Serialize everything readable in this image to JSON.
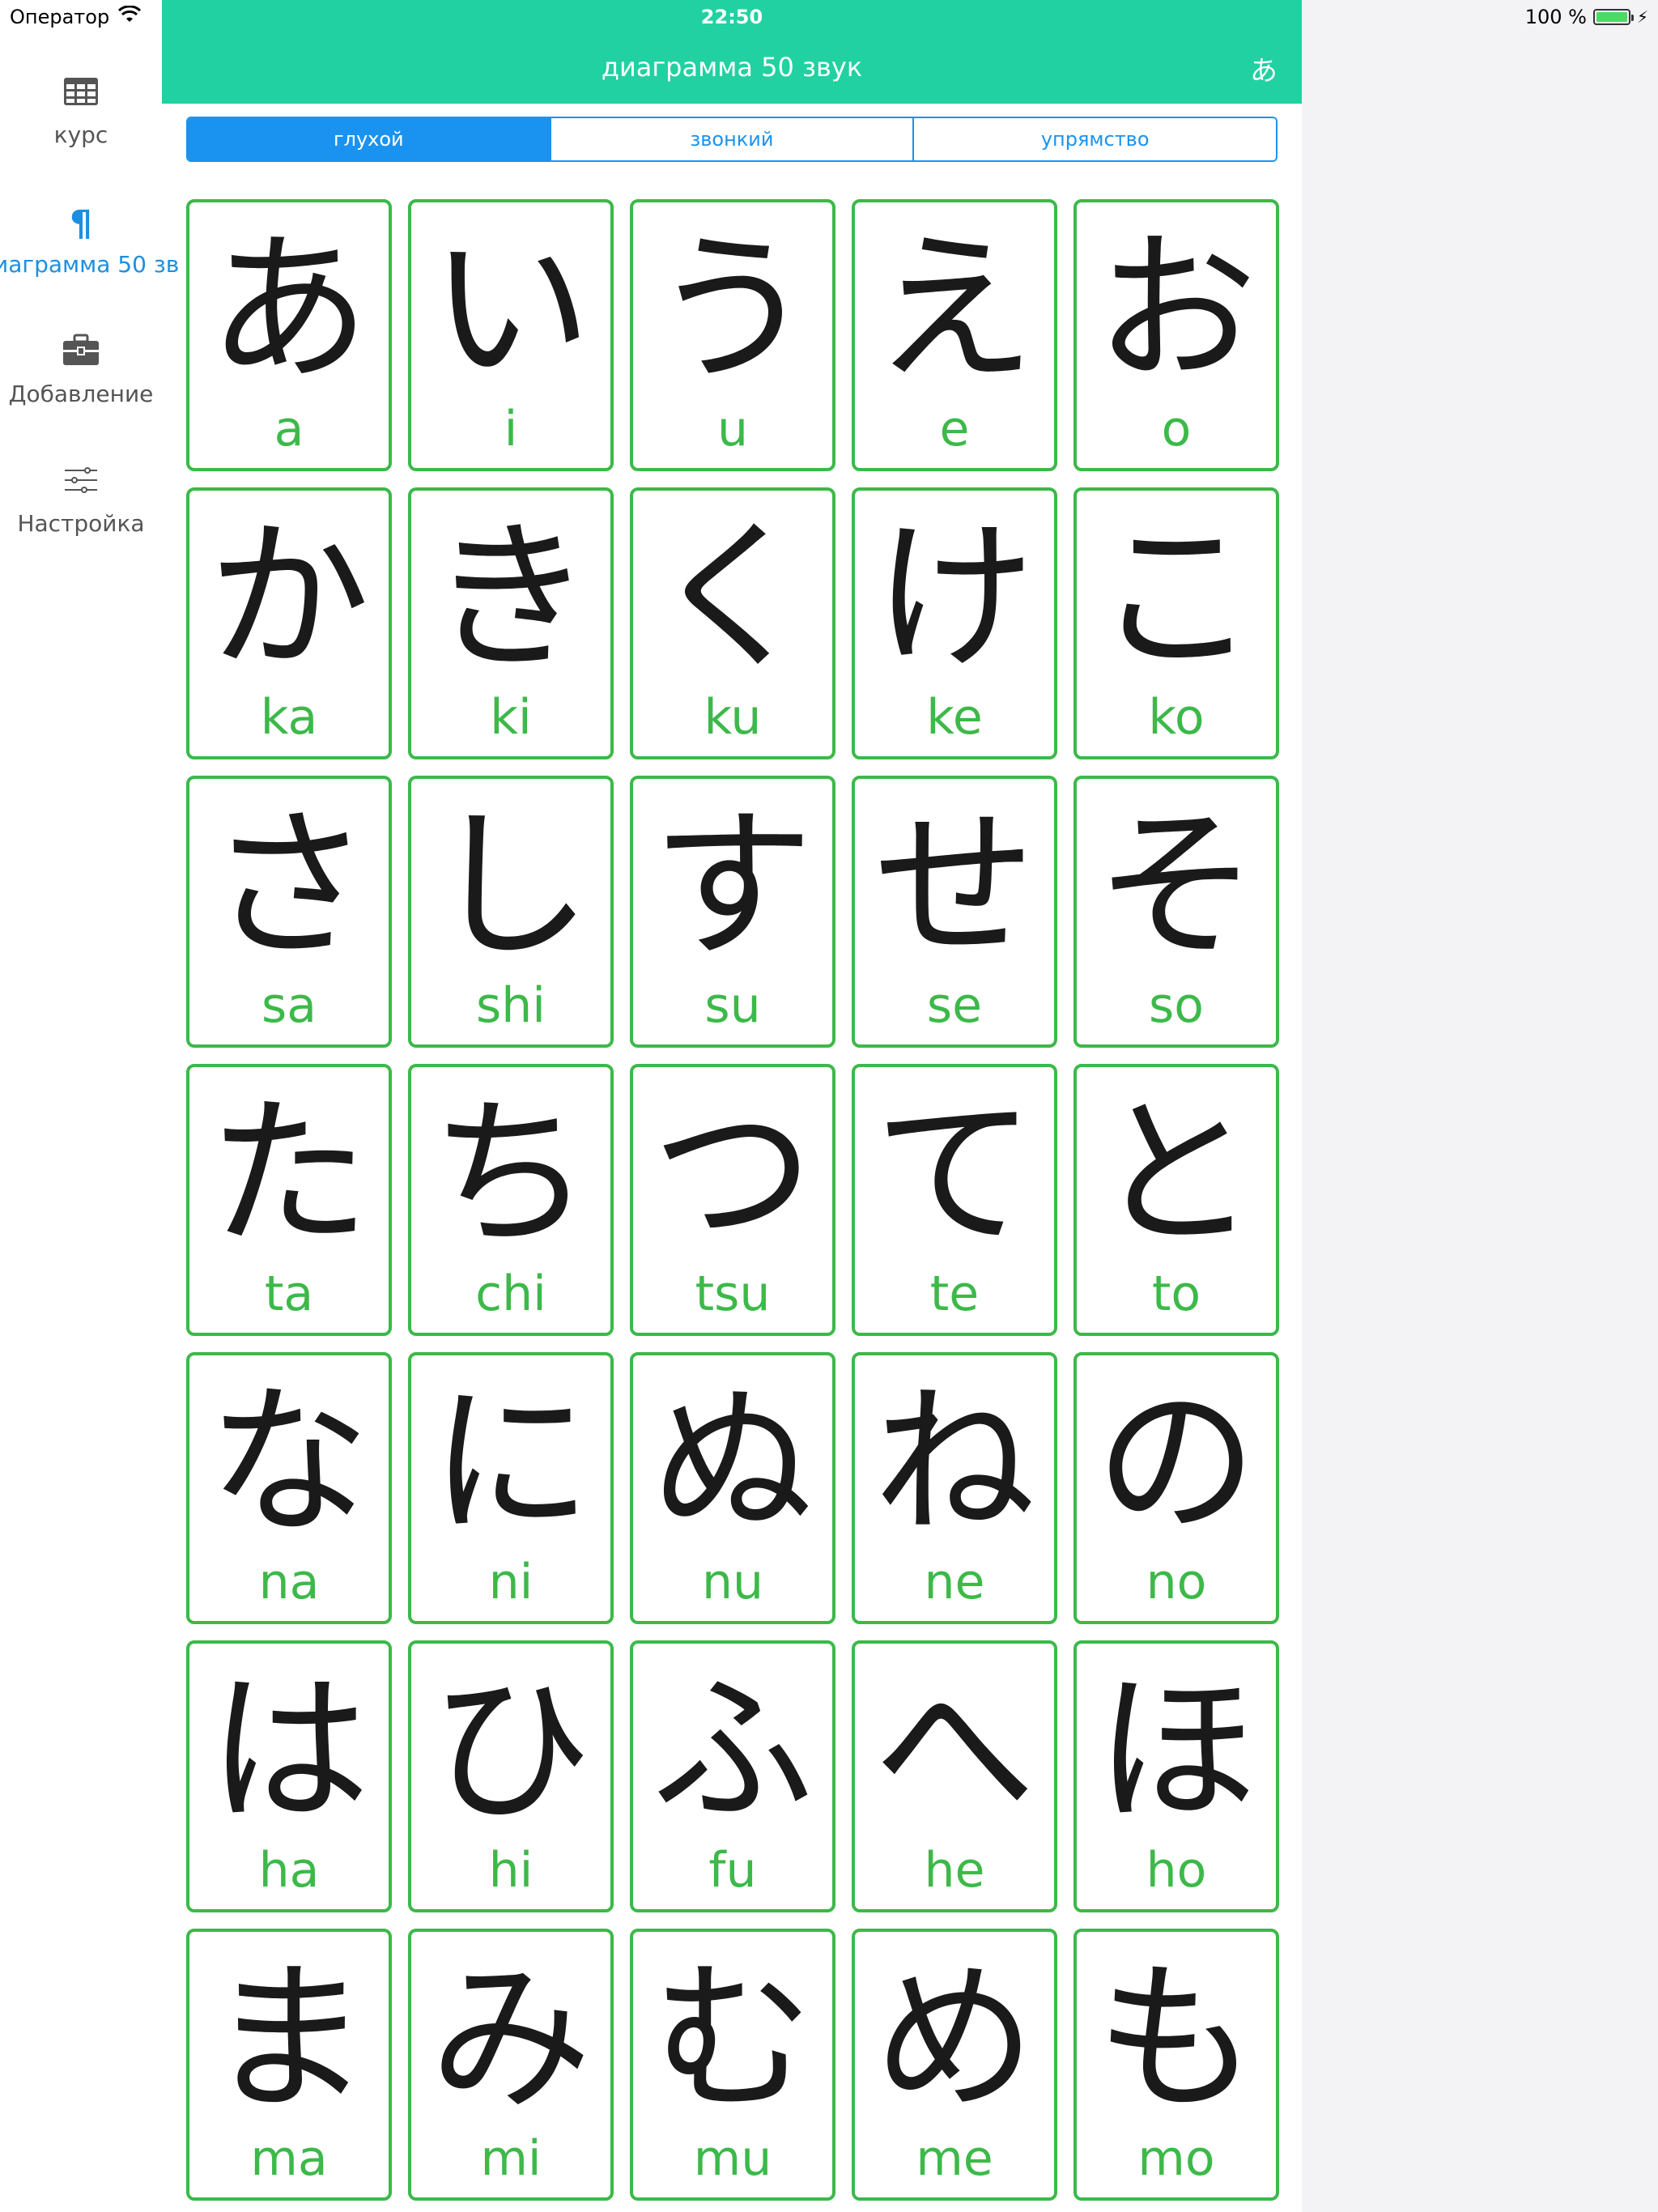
{
  "status": {
    "carrier": "Оператор",
    "time": "22:50",
    "battery_text": "100 %",
    "battery_level": 1.0
  },
  "sidebar": {
    "items": [
      {
        "label": "курс",
        "icon": "table-icon"
      },
      {
        "label": "иаграмма 50 зв",
        "icon": "pilcrow-icon"
      },
      {
        "label": "Добавление",
        "icon": "briefcase-icon"
      },
      {
        "label": "Настройка",
        "icon": "sliders-icon"
      }
    ]
  },
  "header": {
    "title": "диаграмма 50 звук",
    "kana_button": "あ"
  },
  "segments": [
    "глухой",
    "звонкий",
    "упрямство"
  ],
  "cards": [
    {
      "kana": "あ",
      "romaji": "a"
    },
    {
      "kana": "い",
      "romaji": "i"
    },
    {
      "kana": "う",
      "romaji": "u"
    },
    {
      "kana": "え",
      "romaji": "e"
    },
    {
      "kana": "お",
      "romaji": "o"
    },
    {
      "kana": "か",
      "romaji": "ka"
    },
    {
      "kana": "き",
      "romaji": "ki"
    },
    {
      "kana": "く",
      "romaji": "ku"
    },
    {
      "kana": "け",
      "romaji": "ke"
    },
    {
      "kana": "こ",
      "romaji": "ko"
    },
    {
      "kana": "さ",
      "romaji": "sa"
    },
    {
      "kana": "し",
      "romaji": "shi"
    },
    {
      "kana": "す",
      "romaji": "su"
    },
    {
      "kana": "せ",
      "romaji": "se"
    },
    {
      "kana": "そ",
      "romaji": "so"
    },
    {
      "kana": "た",
      "romaji": "ta"
    },
    {
      "kana": "ち",
      "romaji": "chi"
    },
    {
      "kana": "つ",
      "romaji": "tsu"
    },
    {
      "kana": "て",
      "romaji": "te"
    },
    {
      "kana": "と",
      "romaji": "to"
    },
    {
      "kana": "な",
      "romaji": "na"
    },
    {
      "kana": "に",
      "romaji": "ni"
    },
    {
      "kana": "ぬ",
      "romaji": "nu"
    },
    {
      "kana": "ね",
      "romaji": "ne"
    },
    {
      "kana": "の",
      "romaji": "no"
    },
    {
      "kana": "は",
      "romaji": "ha"
    },
    {
      "kana": "ひ",
      "romaji": "hi"
    },
    {
      "kana": "ふ",
      "romaji": "fu"
    },
    {
      "kana": "へ",
      "romaji": "he"
    },
    {
      "kana": "ほ",
      "romaji": "ho"
    },
    {
      "kana": "ま",
      "romaji": "ma"
    },
    {
      "kana": "み",
      "romaji": "mi"
    },
    {
      "kana": "む",
      "romaji": "mu"
    },
    {
      "kana": "め",
      "romaji": "me"
    },
    {
      "kana": "も",
      "romaji": "mo"
    }
  ],
  "colors": {
    "header": "#21d1a1",
    "accent": "#1a93f0",
    "card_border": "#3cb949"
  }
}
